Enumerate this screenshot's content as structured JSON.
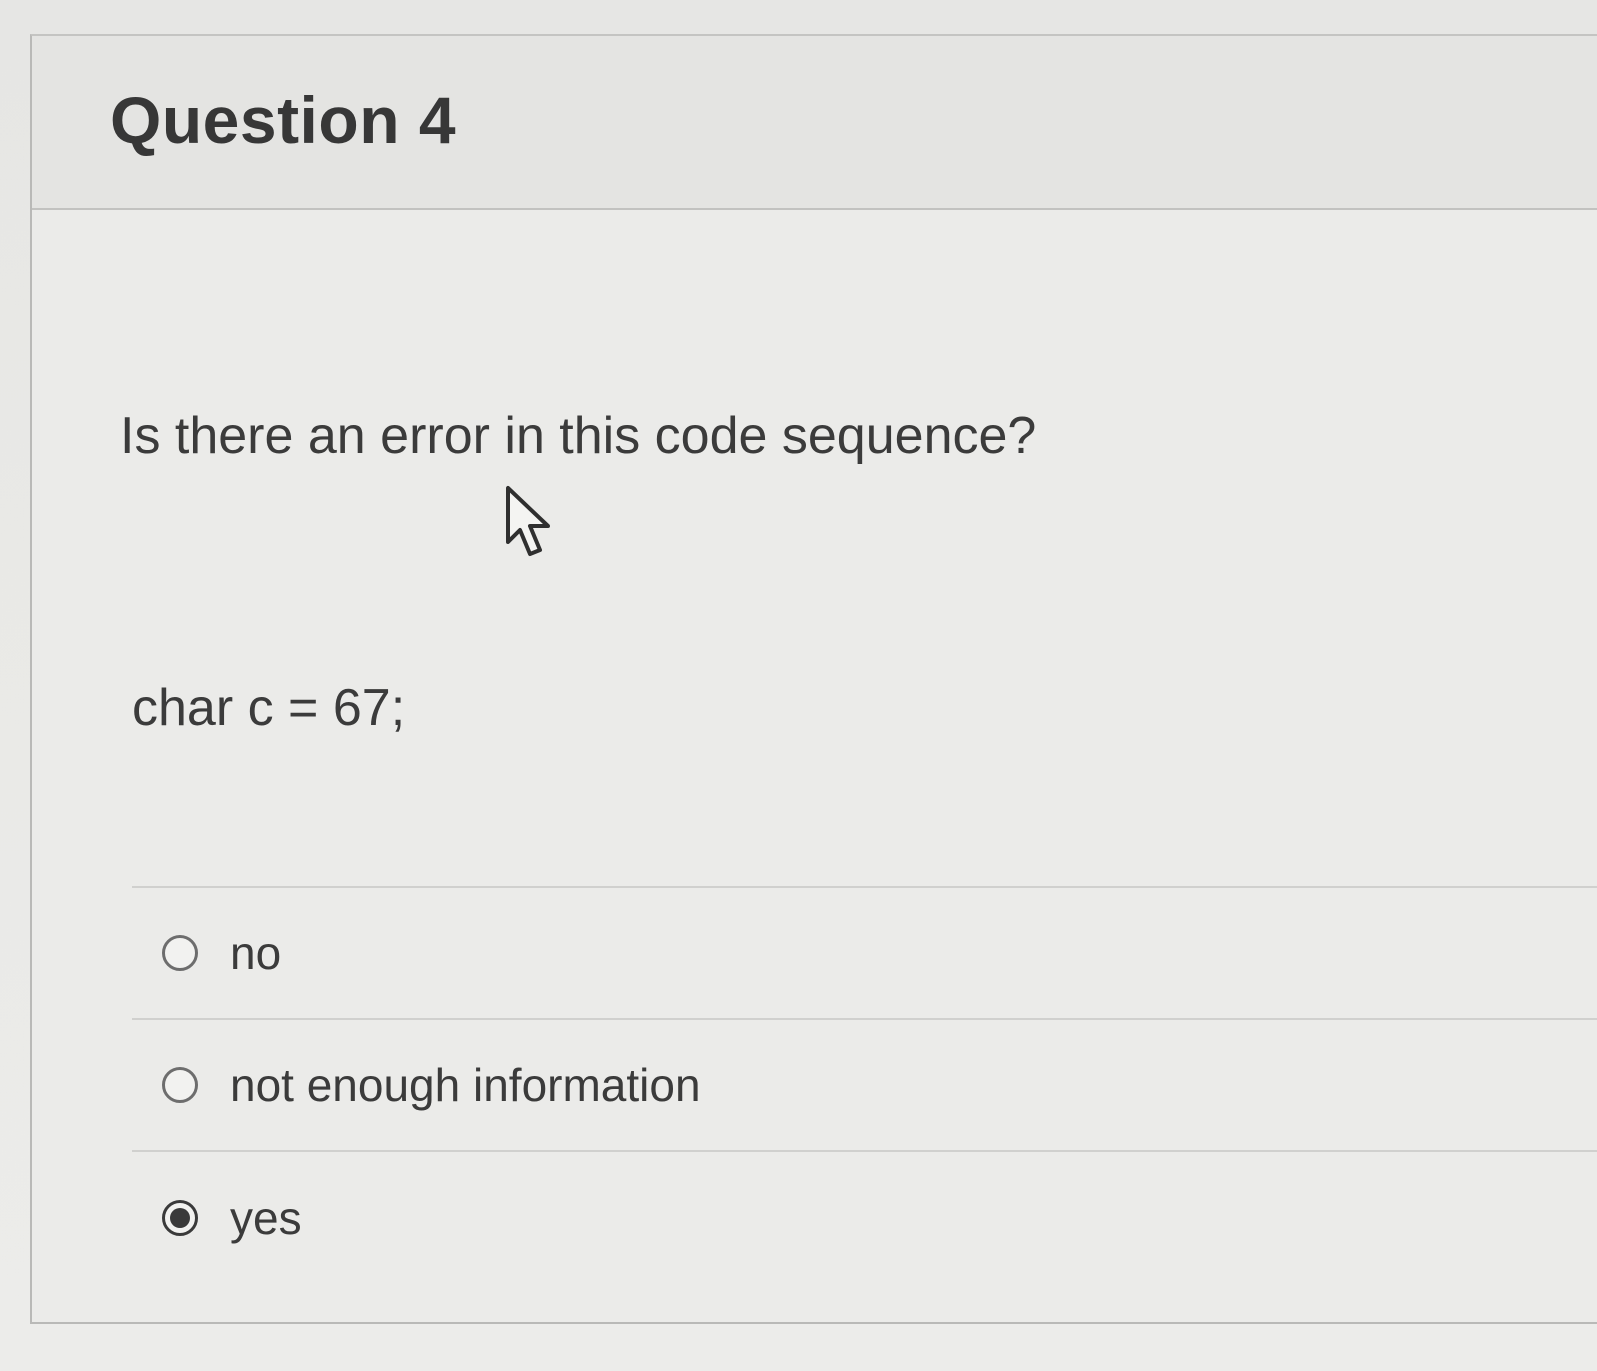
{
  "question": {
    "title": "Question 4",
    "prompt": "Is there an error in this code sequence?",
    "code": "char c = 67;"
  },
  "answers": [
    {
      "label": "no",
      "selected": false
    },
    {
      "label": "not enough information",
      "selected": false
    },
    {
      "label": "yes",
      "selected": true
    }
  ],
  "icons": {
    "cursor": "mouse-pointer-icon"
  }
}
